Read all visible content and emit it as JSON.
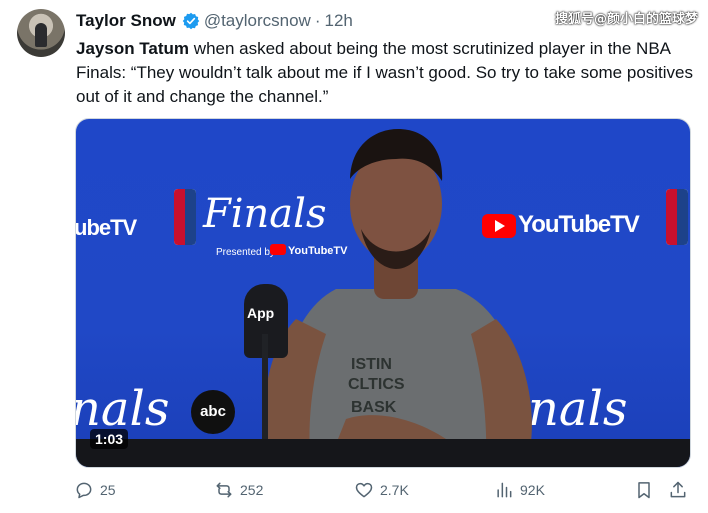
{
  "author": {
    "name": "Taylor Snow",
    "handle": "@taylorcsnow",
    "separator": "·",
    "time": "12h"
  },
  "watermark": "搜狐号@颜小白的篮球梦",
  "tweet": {
    "bold_name": "Jayson Tatum",
    "text": " when asked about being the most scrutinized player in the NBA Finals: “They wouldn’t talk about me if I wasn’t good. So try to take some positives out of it and change the channel.”"
  },
  "media": {
    "duration": "1:03",
    "bg_yt_left": "ubeTV",
    "finals_word": "Finals",
    "presented_by": "Presented by",
    "youtubetv_small": "YouTubeTV",
    "youtubetv_large": "YouTubeTV",
    "abc": "abc",
    "mic_label": "App",
    "finals_low_left": "nals",
    "finals_low_right": "nals",
    "jersey_text": "ISTIN\nCLTICS\nBASK"
  },
  "actions": {
    "replies": "25",
    "reposts": "252",
    "likes": "2.7K",
    "views": "92K"
  },
  "colors": {
    "brand_blue": "#1d9bf0",
    "muted": "#536471",
    "text": "#0f1419",
    "backdrop": "#2048c6"
  }
}
